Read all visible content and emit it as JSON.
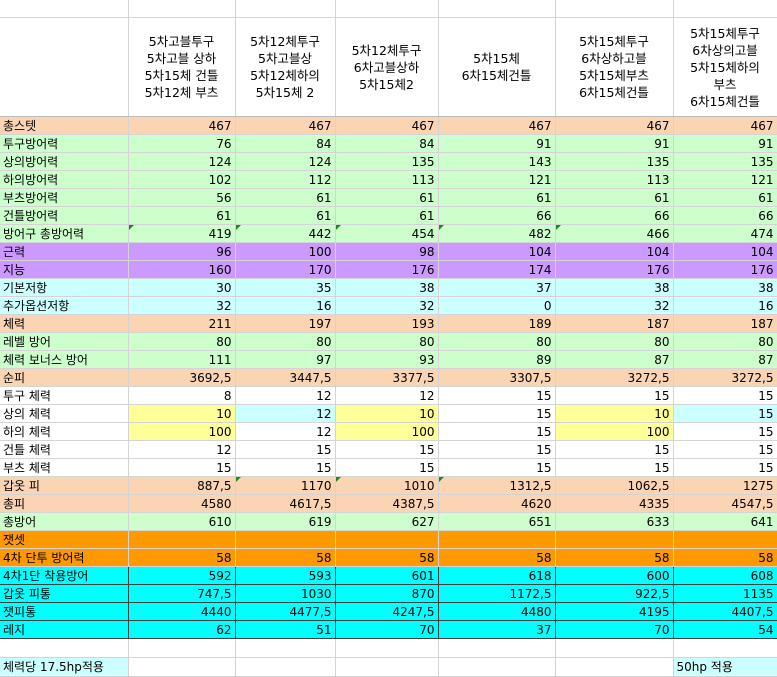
{
  "columns": [
    "5차고블투구\n5차고블 상하\n5차15체 건틀\n5차12체 부츠",
    "5차12체투구\n5차고블상\n5차12체하의\n5차15체 2",
    "5차12체투구\n6차고블상하\n5차15체2",
    "5차15체\n6차15체건틀",
    "5차15체투구\n6차상하고블\n5차15체부츠\n6차15체건틀",
    "5차15체투구\n6차상의고블\n5차15체하의\n부츠\n6차15체건틀"
  ],
  "rows": [
    {
      "label": "총스텟",
      "values": [
        "467",
        "467",
        "467",
        "467",
        "467",
        "467"
      ],
      "bg": "#fbd4b4"
    },
    {
      "label": "투구방어력",
      "values": [
        "76",
        "84",
        "84",
        "91",
        "91",
        "91"
      ],
      "bg": "#ccffcc"
    },
    {
      "label": "상의방어력",
      "values": [
        "124",
        "124",
        "135",
        "143",
        "135",
        "135"
      ],
      "bg": "#ccffcc"
    },
    {
      "label": "하의방어력",
      "values": [
        "102",
        "112",
        "113",
        "121",
        "113",
        "121"
      ],
      "bg": "#ccffcc"
    },
    {
      "label": "부츠방어력",
      "values": [
        "56",
        "61",
        "61",
        "61",
        "61",
        "61"
      ],
      "bg": "#ccffcc"
    },
    {
      "label": "건틀방어력",
      "values": [
        "61",
        "61",
        "61",
        "66",
        "66",
        "66"
      ],
      "bg": "#ccffcc"
    },
    {
      "label": "방어구 총방어력",
      "values": [
        "419",
        "442",
        "454",
        "482",
        "466",
        "474"
      ],
      "bg": "#ccffcc",
      "tri": [
        0,
        1,
        2,
        3,
        4
      ]
    },
    {
      "label": "근력",
      "values": [
        "96",
        "100",
        "98",
        "104",
        "104",
        "104"
      ],
      "bg": "#cc99ff"
    },
    {
      "label": "지능",
      "values": [
        "160",
        "170",
        "176",
        "174",
        "176",
        "176"
      ],
      "bg": "#cc99ff"
    },
    {
      "label": "기본저항",
      "values": [
        "30",
        "35",
        "38",
        "37",
        "38",
        "38"
      ],
      "bg": "#ccffff"
    },
    {
      "label": "추가옵션저항",
      "values": [
        "32",
        "16",
        "32",
        "0",
        "32",
        "16"
      ],
      "bg": "#ccffff"
    },
    {
      "label": "체력",
      "values": [
        "211",
        "197",
        "193",
        "189",
        "187",
        "187"
      ],
      "bg": "#fbd4b4"
    },
    {
      "label": "레벨 방어",
      "values": [
        "80",
        "80",
        "80",
        "80",
        "80",
        "80"
      ],
      "bg": "#ccffcc"
    },
    {
      "label": "체력 보너스 방어",
      "values": [
        "111",
        "97",
        "93",
        "89",
        "87",
        "87"
      ],
      "bg": "#ccffcc"
    },
    {
      "label": "순피",
      "values": [
        "3692,5",
        "3447,5",
        "3377,5",
        "3307,5",
        "3272,5",
        "3272,5"
      ],
      "bg": "#fbd4b4"
    },
    {
      "label": "투구 체력",
      "values": [
        "8",
        "12",
        "12",
        "15",
        "15",
        "15"
      ],
      "bg": "#ffffff"
    },
    {
      "label": "상의 체력",
      "values": [
        "10",
        "12",
        "10",
        "15",
        "10",
        "15"
      ],
      "bg": "#ffffff",
      "cellbg": [
        "#ffff99",
        "#ccffff",
        "#ffff99",
        "#ffffff",
        "#ffff99",
        "#ccffff"
      ]
    },
    {
      "label": "하의 체력",
      "values": [
        "100",
        "12",
        "100",
        "15",
        "100",
        "15"
      ],
      "bg": "#ffffff",
      "cellbg": [
        "#ffff99",
        "#ffffff",
        "#ffff99",
        "#ffffff",
        "#ffff99",
        "#ffffff"
      ]
    },
    {
      "label": "건틀 체력",
      "values": [
        "12",
        "15",
        "15",
        "15",
        "15",
        "15"
      ],
      "bg": "#ffffff"
    },
    {
      "label": "부츠 체력",
      "values": [
        "15",
        "15",
        "15",
        "15",
        "15",
        "15"
      ],
      "bg": "#ffffff"
    },
    {
      "label": "갑옷 피",
      "values": [
        "887,5",
        "1170",
        "1010",
        "1312,5",
        "1062,5",
        "1275"
      ],
      "bg": "#fbd4b4",
      "tri": [
        1,
        2,
        3
      ]
    },
    {
      "label": "총피",
      "values": [
        "4580",
        "4617,5",
        "4387,5",
        "4620",
        "4335",
        "4547,5"
      ],
      "bg": "#fbd4b4"
    },
    {
      "label": "총방어",
      "values": [
        "610",
        "619",
        "627",
        "651",
        "633",
        "641"
      ],
      "bg": "#ccffcc"
    },
    {
      "label": "잿셋",
      "values": [
        "",
        "",
        "",
        "",
        "",
        ""
      ],
      "bg": "#ff9900"
    },
    {
      "label": "4차 단투 방어력",
      "values": [
        "58",
        "58",
        "58",
        "58",
        "58",
        "58"
      ],
      "bg": "#ff9900"
    },
    {
      "label": "4차1단 착용방어",
      "values": [
        "592",
        "593",
        "601",
        "618",
        "600",
        "608"
      ],
      "bg": "#00ffff",
      "dark": true
    },
    {
      "label": "갑옷 피통",
      "values": [
        "747,5",
        "1030",
        "870",
        "1172,5",
        "922,5",
        "1135"
      ],
      "bg": "#00ffff",
      "dark": true
    },
    {
      "label": "잿피통",
      "values": [
        "4440",
        "4477,5",
        "4247,5",
        "4480",
        "4195",
        "4407,5"
      ],
      "bg": "#00ffff",
      "dark": true
    },
    {
      "label": "레지",
      "values": [
        "62",
        "51",
        "70",
        "37",
        "70",
        "54"
      ],
      "bg": "#00ffff",
      "dark": true
    }
  ],
  "footer": {
    "left_note": "체력당 17.5hp적용",
    "right_note": "50hp 적용"
  }
}
